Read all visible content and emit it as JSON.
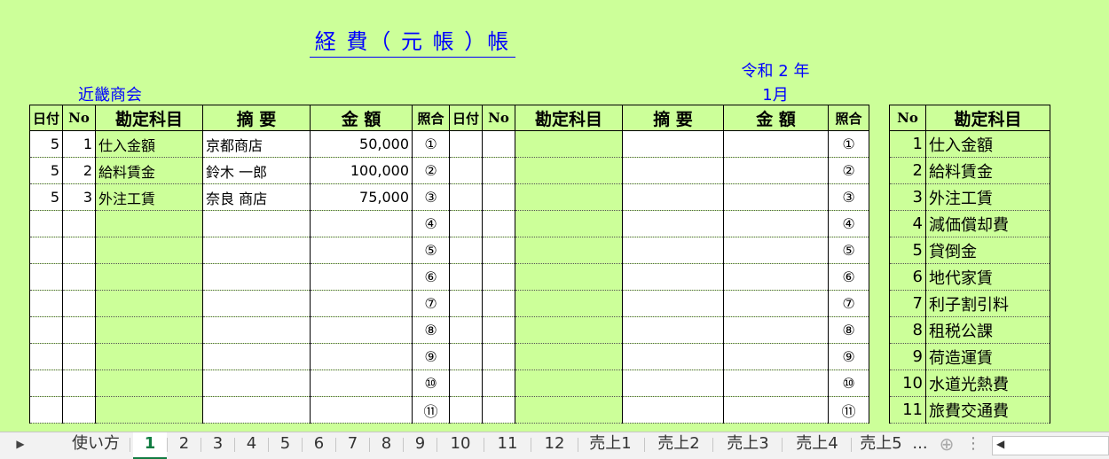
{
  "sheet": {
    "title": "経 費（ 元 帳 ）帳",
    "era": "令和 2 年",
    "month": "1月",
    "company": "近畿商会"
  },
  "ledger": {
    "headers": [
      "日付",
      "No",
      "勘定科目",
      "摘 要",
      "金 額",
      "照合"
    ],
    "rows": [
      {
        "date": "5",
        "no": "1",
        "account": "仕入金額",
        "memo": "京都商店",
        "amount": "50,000",
        "check": "①"
      },
      {
        "date": "5",
        "no": "2",
        "account": "給料賃金",
        "memo": "鈴木 一郎",
        "amount": "100,000",
        "check": "②"
      },
      {
        "date": "5",
        "no": "3",
        "account": "外注工賃",
        "memo": "奈良 商店",
        "amount": "75,000",
        "check": "③"
      },
      {
        "date": "",
        "no": "",
        "account": "",
        "memo": "",
        "amount": "",
        "check": "④"
      },
      {
        "date": "",
        "no": "",
        "account": "",
        "memo": "",
        "amount": "",
        "check": "⑤"
      },
      {
        "date": "",
        "no": "",
        "account": "",
        "memo": "",
        "amount": "",
        "check": "⑥"
      },
      {
        "date": "",
        "no": "",
        "account": "",
        "memo": "",
        "amount": "",
        "check": "⑦"
      },
      {
        "date": "",
        "no": "",
        "account": "",
        "memo": "",
        "amount": "",
        "check": "⑧"
      },
      {
        "date": "",
        "no": "",
        "account": "",
        "memo": "",
        "amount": "",
        "check": "⑨"
      },
      {
        "date": "",
        "no": "",
        "account": "",
        "memo": "",
        "amount": "",
        "check": "⑩"
      },
      {
        "date": "",
        "no": "",
        "account": "",
        "memo": "",
        "amount": "",
        "check": "⑪"
      }
    ]
  },
  "ledger2": {
    "headers": [
      "日付",
      "No",
      "勘定科目",
      "摘 要",
      "金 額",
      "照合"
    ],
    "checks": [
      "①",
      "②",
      "③",
      "④",
      "⑤",
      "⑥",
      "⑦",
      "⑧",
      "⑨",
      "⑩",
      "⑪"
    ]
  },
  "accounts": {
    "headers": [
      "No",
      "勘定科目"
    ],
    "rows": [
      {
        "no": "1",
        "name": "仕入金額"
      },
      {
        "no": "2",
        "name": "給料賃金"
      },
      {
        "no": "3",
        "name": "外注工賃"
      },
      {
        "no": "4",
        "name": "減価償却費"
      },
      {
        "no": "5",
        "name": "貸倒金"
      },
      {
        "no": "6",
        "name": "地代家賃"
      },
      {
        "no": "7",
        "name": "利子割引料"
      },
      {
        "no": "8",
        "name": "租税公課"
      },
      {
        "no": "9",
        "name": "荷造運賃"
      },
      {
        "no": "10",
        "name": "水道光熱費"
      },
      {
        "no": "11",
        "name": "旅費交通費"
      }
    ]
  },
  "tabs": [
    "使い方",
    "1",
    "2",
    "3",
    "4",
    "5",
    "6",
    "7",
    "8",
    "9",
    "10",
    "11",
    "12",
    "売上1",
    "売上2",
    "売上3",
    "売上4",
    "売上5"
  ],
  "tabs_more": "...",
  "active_tab": "1",
  "icons": {
    "nav": "play-right-icon",
    "add": "plus-circle-icon",
    "options": "vertical-dots-icon",
    "scroll": "chevron-left-icon"
  },
  "colors": {
    "sheet_bg": "#ccff99",
    "title_text": "#0000ff",
    "check_mark": "#ff0099",
    "active_tab": "#107c41"
  }
}
